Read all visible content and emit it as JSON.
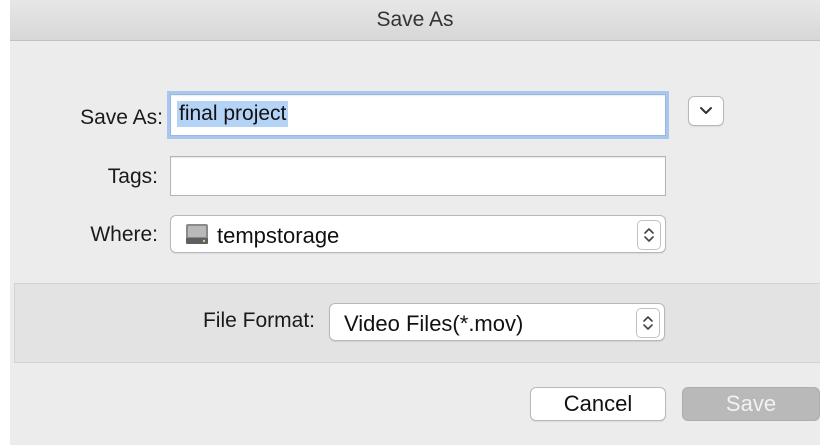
{
  "dialog": {
    "title": "Save As"
  },
  "save_as": {
    "label": "Save As:",
    "value": "final project"
  },
  "tags": {
    "label": "Tags:",
    "value": ""
  },
  "where": {
    "label": "Where:",
    "value": "tempstorage",
    "icon": "hard-drive-icon"
  },
  "file_format": {
    "label": "File Format:",
    "value": "Video Files(*.mov)"
  },
  "buttons": {
    "cancel": "Cancel",
    "save": "Save",
    "expand_icon": "chevron-down-icon"
  },
  "colors": {
    "focus_ring": "#a8c7ef",
    "selection": "#b5d3f7",
    "save_disabled": "#b9b9b9"
  }
}
